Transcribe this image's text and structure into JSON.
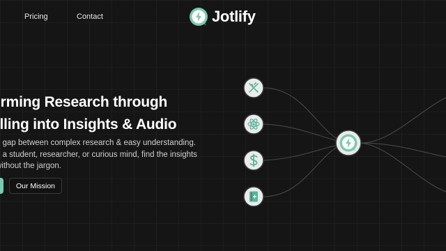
{
  "nav": {
    "pricing_label": "Pricing",
    "contact_label": "Contact"
  },
  "brand": {
    "name": "Jotlify",
    "accent": "#7bc9b0"
  },
  "hero": {
    "headline_line1": "orming Research through",
    "headline_line2": "elling into Insights & Audio",
    "sub_line1": "g gap between complex research & easy understanding.",
    "sub_line2": "e a student, researcher, or curious mind, find the insights",
    "sub_line3": "without the jargon.",
    "mission_button": "Our Mission"
  },
  "diagram": {
    "nodes": [
      {
        "name": "dna-icon"
      },
      {
        "name": "atom-icon"
      },
      {
        "name": "dollar-icon"
      },
      {
        "name": "book-icon"
      }
    ],
    "hub": "jotlify-logo-icon"
  }
}
